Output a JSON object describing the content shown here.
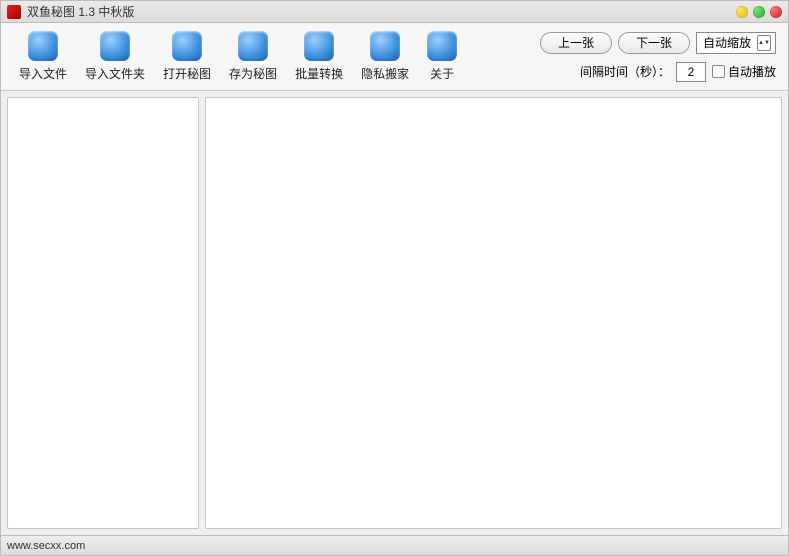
{
  "window": {
    "title": "双鱼秘图 1.3 中秋版"
  },
  "toolbar": {
    "items": [
      {
        "label": "导入文件"
      },
      {
        "label": "导入文件夹"
      },
      {
        "label": "打开秘图"
      },
      {
        "label": "存为秘图"
      },
      {
        "label": "批量转换"
      },
      {
        "label": "隐私搬家"
      },
      {
        "label": "关于"
      }
    ]
  },
  "controls": {
    "prev_label": "上一张",
    "next_label": "下一张",
    "zoom_mode": "自动缩放",
    "interval_label": "间隔时间（秒）：",
    "interval_value": "2",
    "autoplay_label": "自动播放"
  },
  "status": {
    "text": "www.secxx.com"
  }
}
